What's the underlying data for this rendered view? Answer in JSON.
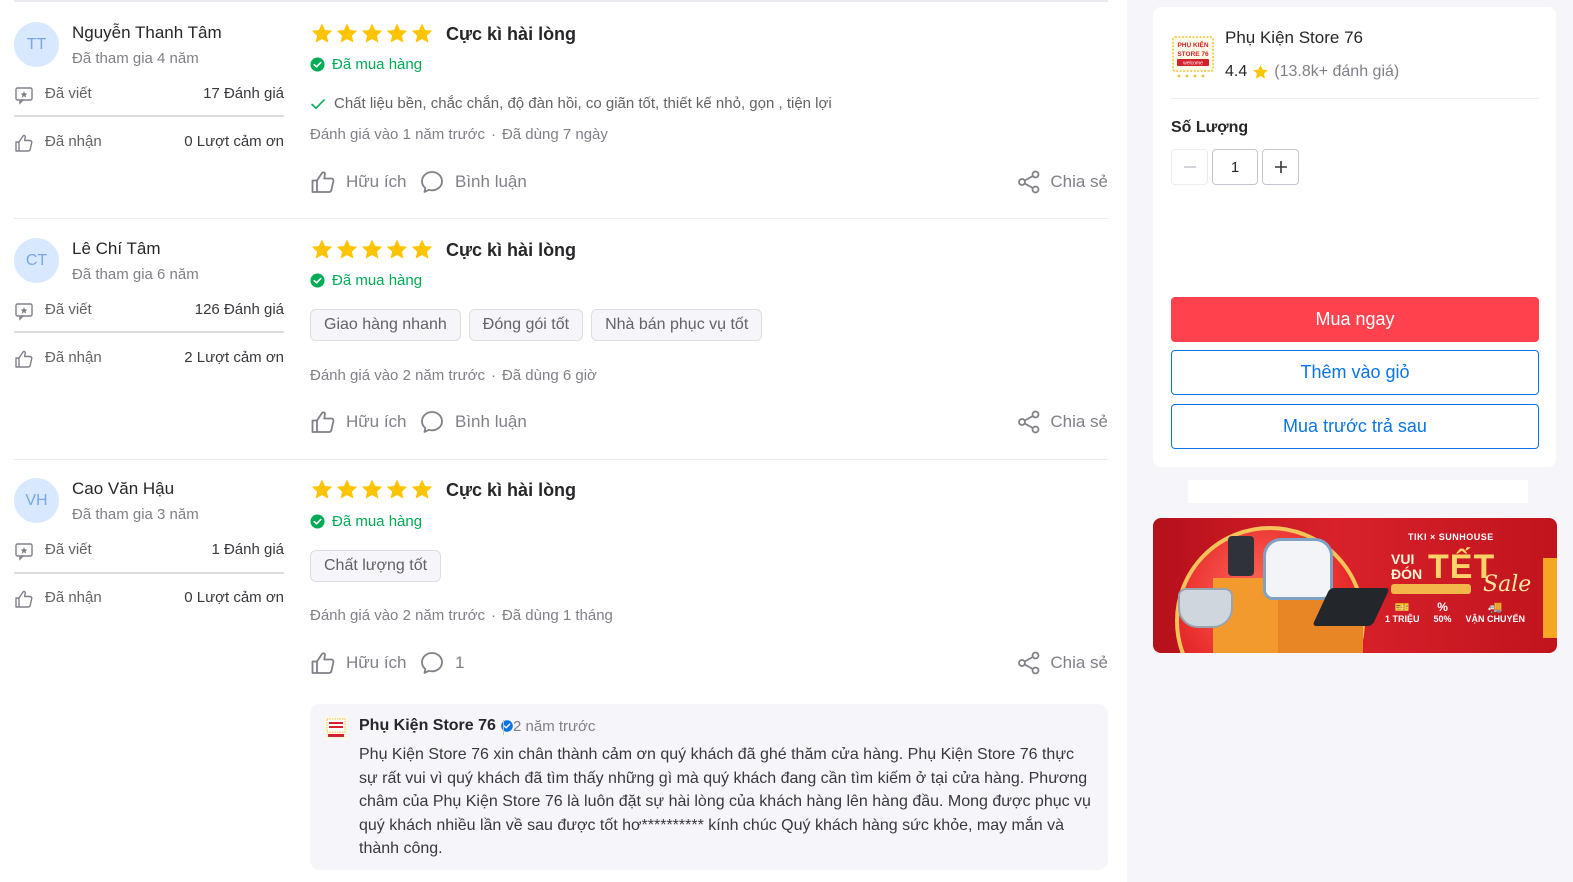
{
  "reviews": [
    {
      "initials": "TT",
      "name": "Nguyễn Thanh Tâm",
      "joined": "Đã tham gia 4 năm",
      "written_label": "Đã viết",
      "written_value": "17 Đánh giá",
      "received_label": "Đã nhận",
      "received_value": "0 Lượt cảm ơn",
      "rating": 5,
      "title": "Cực kì hài lòng",
      "bought": "Đã mua hàng",
      "attribute": "Chất liệu bền, chắc chắn, độ đàn hồi, co giãn tốt, thiết kế nhỏ, gọn , tiện lợi",
      "tags": [],
      "date": "Đánh giá vào 1 năm trước",
      "used": "Đã dùng 7 ngày",
      "helpful": "Hữu ích",
      "comment": "Bình luận",
      "share": "Chia sẻ"
    },
    {
      "initials": "CT",
      "name": "Lê Chí Tâm",
      "joined": "Đã tham gia 6 năm",
      "written_label": "Đã viết",
      "written_value": "126 Đánh giá",
      "received_label": "Đã nhận",
      "received_value": "2 Lượt cảm ơn",
      "rating": 5,
      "title": "Cực kì hài lòng",
      "bought": "Đã mua hàng",
      "tags": [
        "Giao hàng nhanh",
        "Đóng gói tốt",
        "Nhà bán phục vụ tốt"
      ],
      "date": "Đánh giá vào 2 năm trước",
      "used": "Đã dùng 6 giờ",
      "helpful": "Hữu ích",
      "comment": "Bình luận",
      "share": "Chia sẻ"
    },
    {
      "initials": "VH",
      "name": "Cao Văn Hậu",
      "joined": "Đã tham gia 3 năm",
      "written_label": "Đã viết",
      "written_value": "1 Đánh giá",
      "received_label": "Đã nhận",
      "received_value": "0 Lượt cảm ơn",
      "rating": 5,
      "title": "Cực kì hài lòng",
      "bought": "Đã mua hàng",
      "tags": [
        "Chất lượng tốt"
      ],
      "date": "Đánh giá vào 2 năm trước",
      "used": "Đã dùng 1 tháng",
      "helpful": "Hữu ích",
      "comment": "1",
      "share": "Chia sẻ"
    }
  ],
  "reply": {
    "name": "Phụ Kiện Store 76",
    "time": "2 năm trước",
    "text": "Phụ Kiện Store 76 xin chân thành cảm ơn quý khách đã ghé thăm cửa hàng. Phụ Kiện Store 76 thực sự rất vui vì quý khách đã tìm thấy những gì mà quý khách đang cần tìm kiếm ở tại cửa hàng. Phương châm của Phụ Kiện Store 76 là luôn đặt sự hài lòng của khách hàng lên hàng đầu. Mong được phục vụ quý khách nhiều lần về sau được tốt hơ********** kính chúc Quý khách hàng sức khỏe, may mắn và thành công."
  },
  "store": {
    "name": "Phụ Kiện Store 76",
    "rating": "4.4",
    "reviews": "(13.8k+ đánh giá)",
    "logo_text": "PHỤ KIỆN STORE 76 welcome"
  },
  "purchase": {
    "qty_label": "Số Lượng",
    "qty_value": "1",
    "buy_now": "Mua ngay",
    "add_to_cart": "Thêm vào giỏ",
    "buy_later": "Mua trước trả sau"
  },
  "banner": {
    "brand": "TIKI × SUNHOUSE",
    "line1": "VUI",
    "line2": "ĐÓN",
    "tet": "TẾT",
    "sale": "Sale",
    "perk1_big": "1 TRIỆU",
    "perk2_big": "50%",
    "perk3_big": "VẬN CHUYỂN"
  },
  "colors": {
    "star": "#ffc400",
    "bought": "#00ab56",
    "buy_now": "#ff424e",
    "link_blue": "#0b74e5"
  }
}
